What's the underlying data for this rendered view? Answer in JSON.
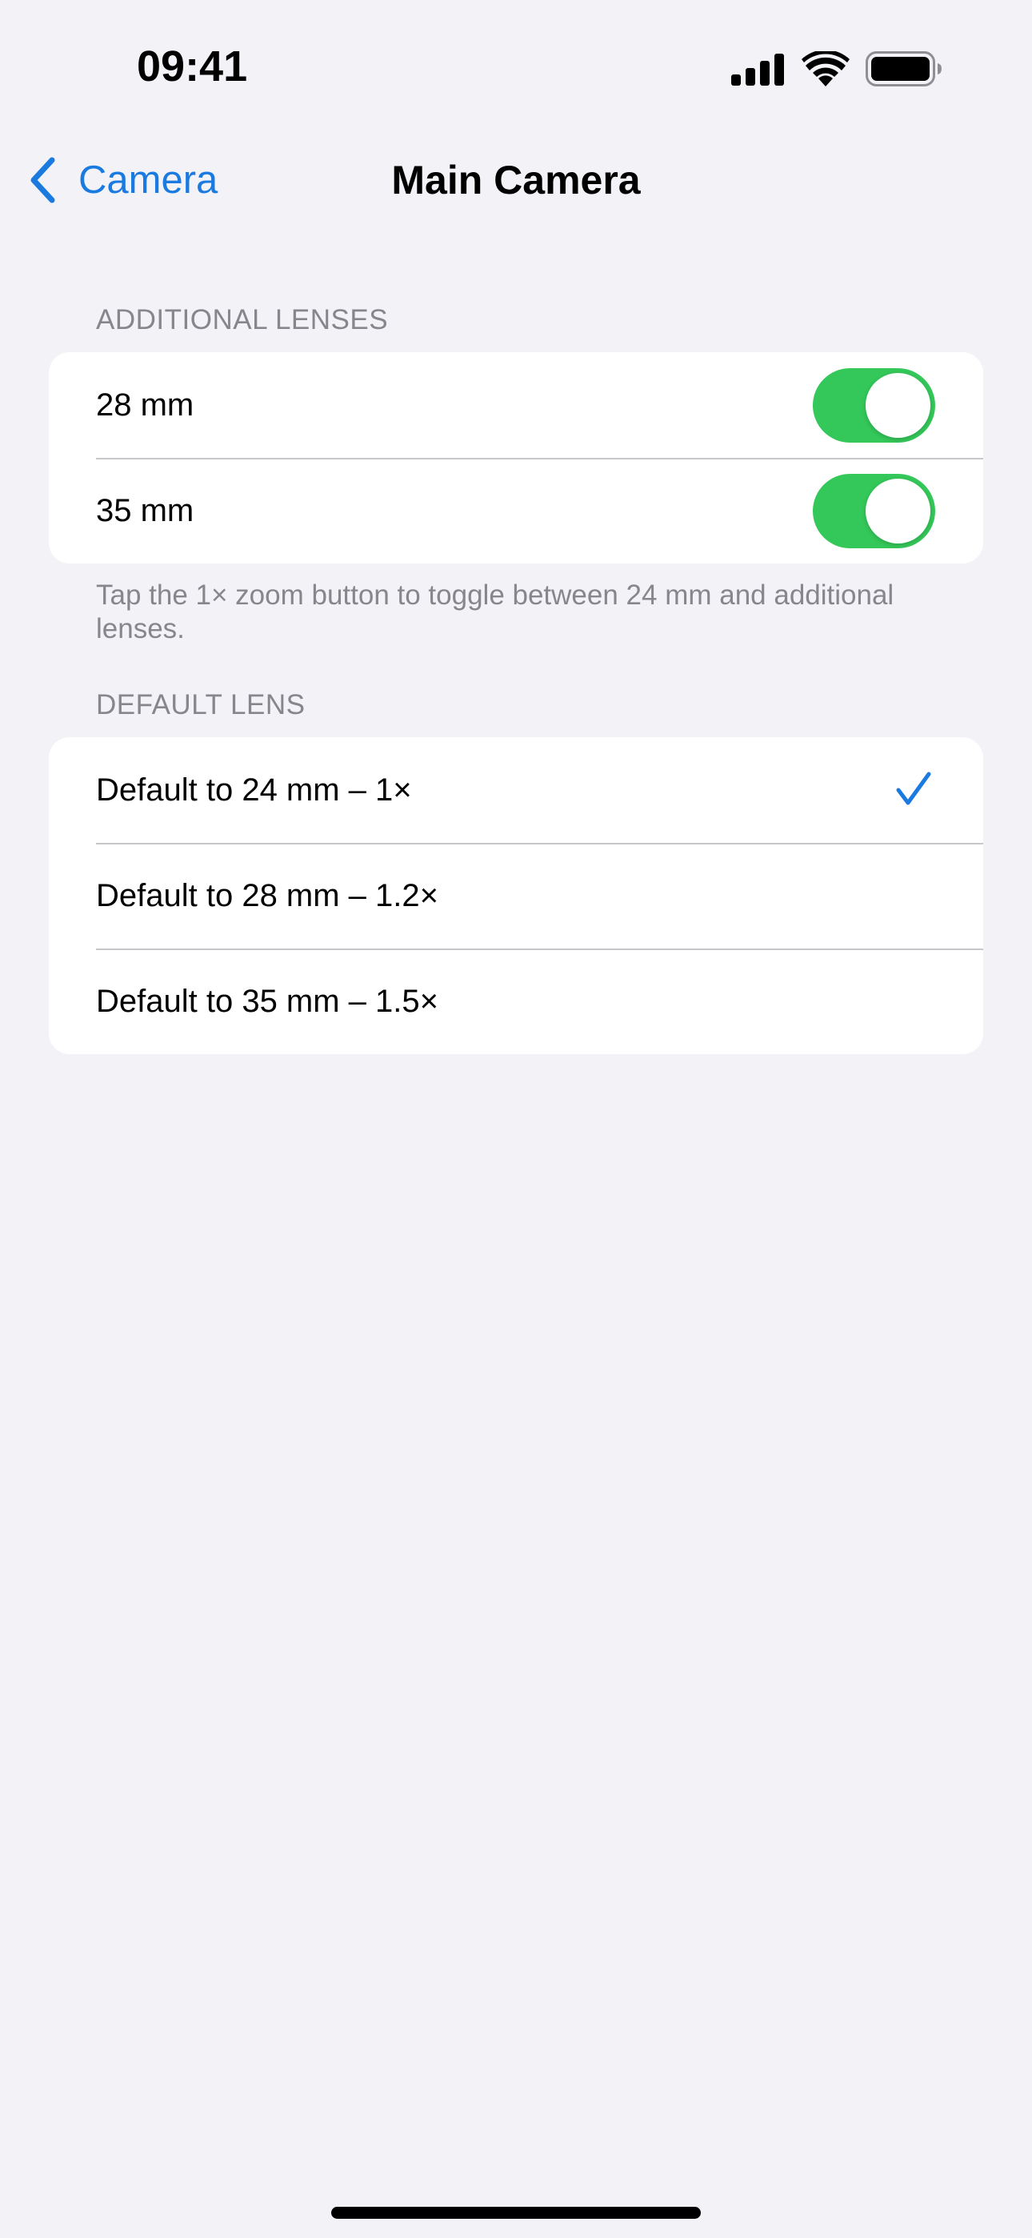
{
  "status_bar": {
    "time": "09:41",
    "icons": [
      "cellular-signal-icon",
      "wifi-icon",
      "battery-icon"
    ]
  },
  "nav": {
    "back_label": "Camera",
    "back_icon": "chevron-left-icon",
    "title": "Main Camera"
  },
  "additional_lenses": {
    "header": "ADDITIONAL LENSES",
    "items": [
      {
        "label": "28 mm",
        "enabled": true
      },
      {
        "label": "35 mm",
        "enabled": true
      }
    ],
    "footer": "Tap the 1× zoom button to toggle between 24 mm and additional lenses."
  },
  "default_lens": {
    "header": "DEFAULT LENS",
    "items": [
      {
        "label": "Default to 24 mm – 1×",
        "selected": true
      },
      {
        "label": "Default to 28 mm – 1.2×",
        "selected": false
      },
      {
        "label": "Default to 35 mm – 1.5×",
        "selected": false
      }
    ]
  },
  "colors": {
    "accent": "#1a7ae0",
    "toggle_on": "#34c759",
    "background": "#f2f2f7"
  }
}
